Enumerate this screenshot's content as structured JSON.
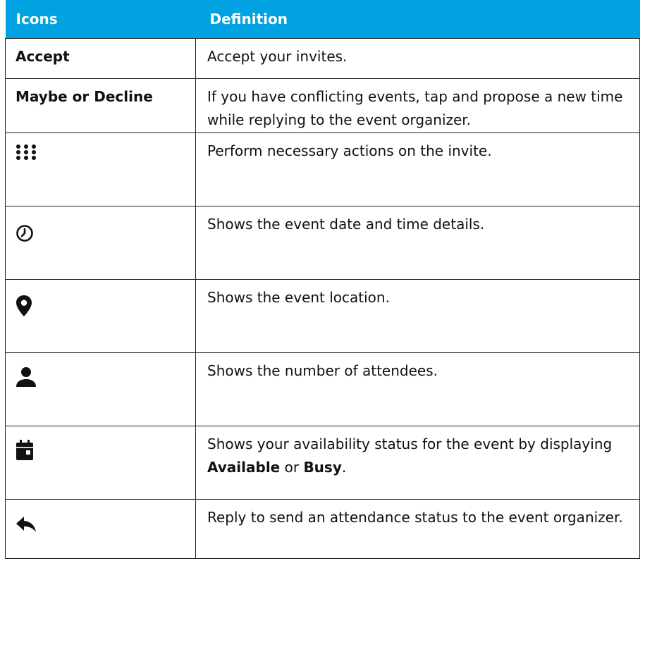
{
  "table": {
    "header": {
      "col1": "Icons",
      "col2": "Definition"
    },
    "rows": [
      {
        "label": "Accept",
        "definition": "Accept your invites."
      },
      {
        "label": "Maybe or Decline",
        "definition": "If you have conflicting events, tap and propose a new time while replying to the event organizer."
      },
      {
        "icon": "more-dots-icon",
        "definition": "Perform necessary actions on the invite."
      },
      {
        "icon": "clock-icon",
        "definition": "Shows the event date and time details."
      },
      {
        "icon": "location-pin-icon",
        "definition": "Shows the event location."
      },
      {
        "icon": "person-icon",
        "definition": "Shows the number of attendees."
      },
      {
        "icon": "calendar-icon",
        "definition_pre": "Shows your availability status for the event by displaying ",
        "definition_bold1": "Available",
        "definition_mid": " or ",
        "definition_bold2": "Busy",
        "definition_post": "."
      },
      {
        "icon": "reply-icon",
        "definition": "Reply to send an attendance status to the event organizer."
      }
    ]
  },
  "colors": {
    "header_bg": "#00a2e2",
    "header_text": "#ffffff",
    "border": "#222222",
    "text": "#111111"
  }
}
